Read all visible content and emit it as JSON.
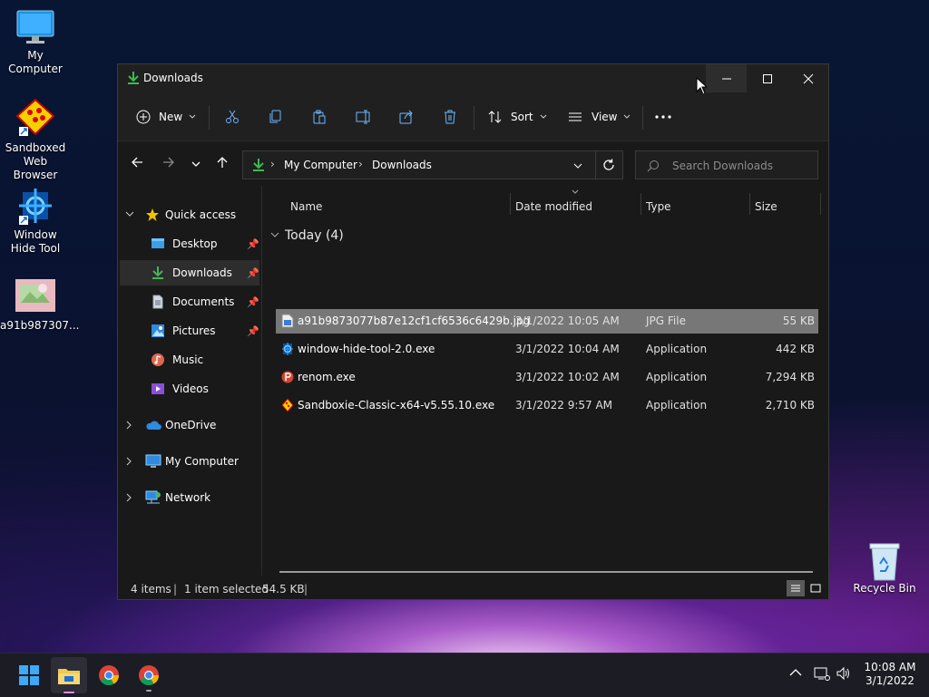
{
  "desktop": {
    "icons": [
      {
        "label": "My Computer"
      },
      {
        "label": "Sandboxed Web Browser"
      },
      {
        "label": "Window Hide Tool"
      },
      {
        "label": "a91b987307..."
      },
      {
        "label": "Recycle Bin"
      }
    ]
  },
  "window": {
    "title": "Downloads",
    "toolbar": {
      "new_label": "New",
      "sort_label": "Sort",
      "view_label": "View"
    },
    "address": {
      "crumbs": [
        "My Computer",
        "Downloads"
      ]
    },
    "search": {
      "placeholder": "Search Downloads"
    },
    "navpane": {
      "quick_access": "Quick access",
      "items": [
        {
          "label": "Desktop",
          "pinned": true
        },
        {
          "label": "Downloads",
          "pinned": true,
          "selected": true
        },
        {
          "label": "Documents",
          "pinned": true
        },
        {
          "label": "Pictures",
          "pinned": true
        },
        {
          "label": "Music",
          "pinned": false
        },
        {
          "label": "Videos",
          "pinned": false
        }
      ],
      "roots": [
        {
          "label": "OneDrive"
        },
        {
          "label": "My Computer"
        },
        {
          "label": "Network"
        }
      ]
    },
    "columns": [
      "Name",
      "Date modified",
      "Type",
      "Size"
    ],
    "group": "Today (4)",
    "files": [
      {
        "name": "a91b9873077b87e12cf1cf6536c6429b.jpg",
        "date": "3/1/2022 10:05 AM",
        "type": "JPG File",
        "size": "55 KB",
        "selected": true
      },
      {
        "name": "window-hide-tool-2.0.exe",
        "date": "3/1/2022 10:04 AM",
        "type": "Application",
        "size": "442 KB",
        "selected": false
      },
      {
        "name": "renom.exe",
        "date": "3/1/2022 10:02 AM",
        "type": "Application",
        "size": "7,294 KB",
        "selected": false
      },
      {
        "name": "Sandboxie-Classic-x64-v5.55.10.exe",
        "date": "3/1/2022 9:57 AM",
        "type": "Application",
        "size": "2,710 KB",
        "selected": false
      }
    ],
    "status": {
      "items": "4 items",
      "selected": "1 item selected",
      "size": "54.5 KB"
    }
  },
  "taskbar": {
    "time": "10:08 AM",
    "date": "3/1/2022"
  },
  "colors": {
    "accent": "#4cc2ff",
    "selected_row": "#777777",
    "download_green": "#3fb950"
  }
}
